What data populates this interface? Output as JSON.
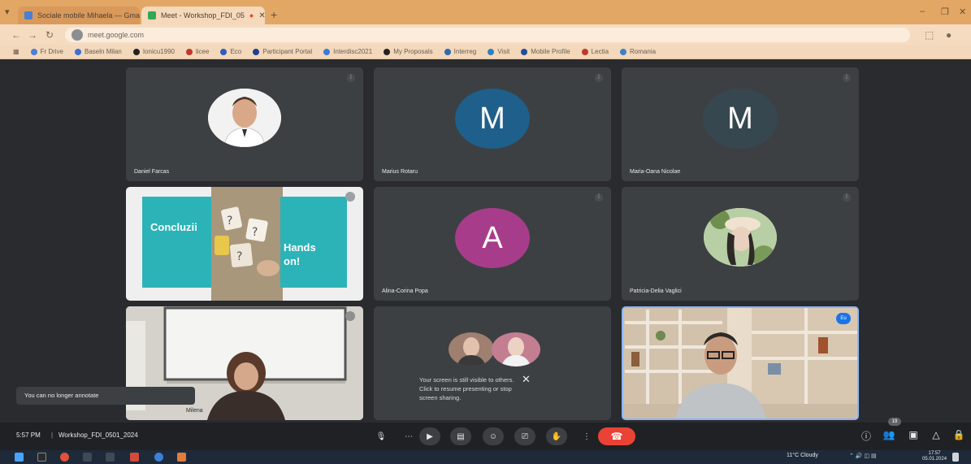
{
  "browser": {
    "tabs": [
      {
        "label": "Sociale mobile Mihaela — Gmail",
        "active": false
      },
      {
        "label": "Meet - Workshop_FDI_05",
        "active": true
      }
    ],
    "url": "meet.google.com",
    "bookmarks": [
      "Fr Drive",
      "Baseln Milan",
      "Ionicu1990",
      "licee",
      "Eco",
      "Participant Portal",
      "Interdisc2021",
      "My Proposals",
      "Interreg",
      "Visit",
      "Mobile Profile",
      "Lectia",
      "Romania"
    ]
  },
  "participants": [
    {
      "name": "Daniel Farcas",
      "initial": "",
      "avatar_color": "",
      "kind": "photo"
    },
    {
      "name": "Marius Rotaru",
      "initial": "M",
      "avatar_color": "#1f5f8b",
      "kind": "letter"
    },
    {
      "name": "Maria-Oana Nicolae",
      "initial": "M",
      "avatar_color": "#37474f",
      "kind": "letter"
    },
    {
      "name": "Alina-Corina Popa",
      "initial": "A",
      "avatar_color": "#a73d8a",
      "kind": "letter"
    },
    {
      "name": "Patricia-Delia Vaglici",
      "initial": "",
      "avatar_color": "",
      "kind": "photo"
    }
  ],
  "slide": {
    "left_text": "Concluzii",
    "right_text": "Hands on!"
  },
  "screen_share": {
    "notice": "Your screen is still visible to others. Click to resume presenting or stop screen sharing."
  },
  "self_badge": "Eu",
  "toast": "You can no longer annotate",
  "controls": {
    "time": "5:57 PM",
    "separator": "|",
    "meeting_code": "Workshop_FDI_0501_2024",
    "people_count": "19"
  },
  "taskbar": {
    "weather": "11°C Cloudy",
    "time": "17:57",
    "date": "05.01.2024"
  }
}
